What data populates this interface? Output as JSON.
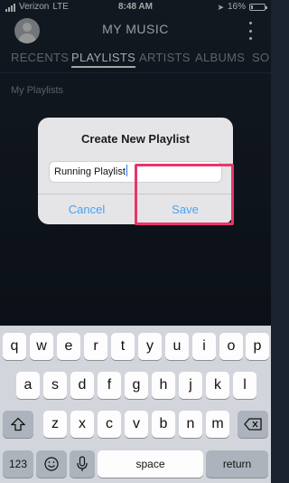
{
  "status": {
    "carrier": "Verizon",
    "network": "LTE",
    "time": "8:48 AM",
    "battery": "16%",
    "battery_level": 0.16
  },
  "header": {
    "title": "MY MUSIC"
  },
  "tabs": [
    {
      "label": "RECENTS"
    },
    {
      "label": "PLAYLISTS",
      "active": true
    },
    {
      "label": "ARTISTS"
    },
    {
      "label": "ALBUMS"
    },
    {
      "label": "SO"
    }
  ],
  "section": {
    "label": "My Playlists"
  },
  "dialog": {
    "title": "Create New Playlist",
    "input_value": "Running Playlist",
    "cancel_label": "Cancel",
    "save_label": "Save"
  },
  "keyboard": {
    "row1": [
      "q",
      "w",
      "e",
      "r",
      "t",
      "y",
      "u",
      "i",
      "o",
      "p"
    ],
    "row2": [
      "a",
      "s",
      "d",
      "f",
      "g",
      "h",
      "j",
      "k",
      "l"
    ],
    "row3": [
      "z",
      "x",
      "c",
      "v",
      "b",
      "n",
      "m"
    ],
    "numbers_label": "123",
    "space_label": "space",
    "return_label": "return"
  },
  "colors": {
    "accent": "#4aa3f2",
    "highlight": "#e8366a",
    "background": "#1a2230"
  }
}
